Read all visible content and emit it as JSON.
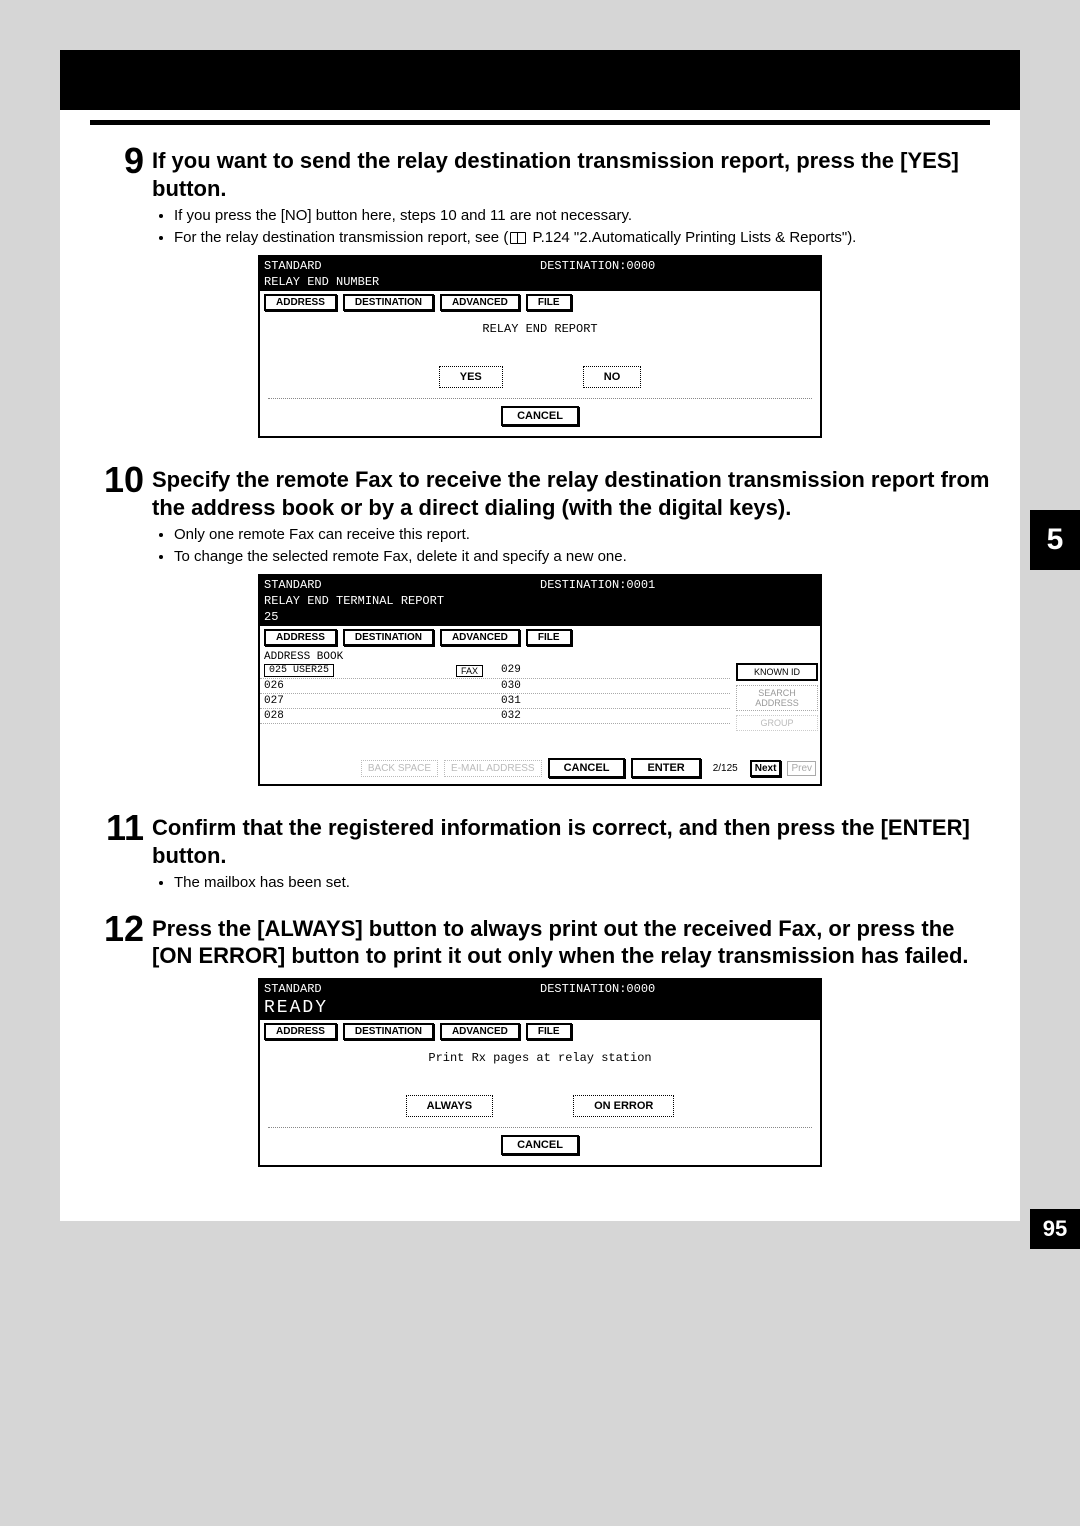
{
  "chapter": "5",
  "page_number": "95",
  "steps": {
    "s9": {
      "num": "9",
      "title": "If you want to send the relay destination transmission report, press the [YES] button.",
      "notes": [
        "If you press the [NO] button here, steps 10 and 11 are not necessary.",
        "For the relay destination transmission report, see (  P.124 \"2.Automatically Printing Lists & Reports\")."
      ]
    },
    "s10": {
      "num": "10",
      "title": "Specify the remote Fax to receive the relay destination transmission report from the address book or by a direct dialing (with the digital keys).",
      "notes": [
        "Only one remote Fax can receive this report.",
        "To change the selected remote Fax, delete it and specify a new one."
      ]
    },
    "s11": {
      "num": "11",
      "title": "Confirm that the registered information is correct, and then press the [ENTER] button.",
      "notes": [
        "The mailbox has been set."
      ]
    },
    "s12": {
      "num": "12",
      "title": "Press the [ALWAYS] button to always print out the received Fax, or press the [ON ERROR] button to print it out only when the relay transmission has failed."
    }
  },
  "screen9": {
    "mode": "STANDARD",
    "dest_label": "DESTINATION:",
    "dest_value": "0000",
    "subtitle": "RELAY END NUMBER",
    "tabs": {
      "address": "ADDRESS",
      "destination": "DESTINATION",
      "advanced": "ADVANCED",
      "file": "FILE"
    },
    "body_title": "RELAY END REPORT",
    "yes": "YES",
    "no": "NO",
    "cancel": "CANCEL"
  },
  "screen10": {
    "mode": "STANDARD",
    "dest_label": "DESTINATION:",
    "dest_value": "0001",
    "subtitle": "RELAY END TERMINAL REPORT",
    "input": "25",
    "tabs": {
      "address": "ADDRESS",
      "destination": "DESTINATION",
      "advanced": "ADVANCED",
      "file": "FILE"
    },
    "section": "ADDRESS BOOK",
    "rows_left": [
      "025 USER25",
      "026",
      "027",
      "028"
    ],
    "rows_right": [
      "029",
      "030",
      "031",
      "032"
    ],
    "fax_tag": "FAX",
    "right_panel": {
      "known": "KNOWN ID",
      "search": "SEARCH ADDRESS",
      "group": "GROUP"
    },
    "footer": {
      "backspace": "BACK SPACE",
      "email": "E-MAIL ADDRESS",
      "cancel": "CANCEL",
      "enter": "ENTER",
      "page": "2/125",
      "next": "Next",
      "prev": "Prev"
    }
  },
  "screen12": {
    "mode": "STANDARD",
    "dest_label": "DESTINATION:",
    "dest_value": "0000",
    "ready": "READY",
    "tabs": {
      "address": "ADDRESS",
      "destination": "DESTINATION",
      "advanced": "ADVANCED",
      "file": "FILE"
    },
    "body_title": "Print Rx pages at relay station",
    "always": "ALWAYS",
    "onerror": "ON ERROR",
    "cancel": "CANCEL"
  }
}
